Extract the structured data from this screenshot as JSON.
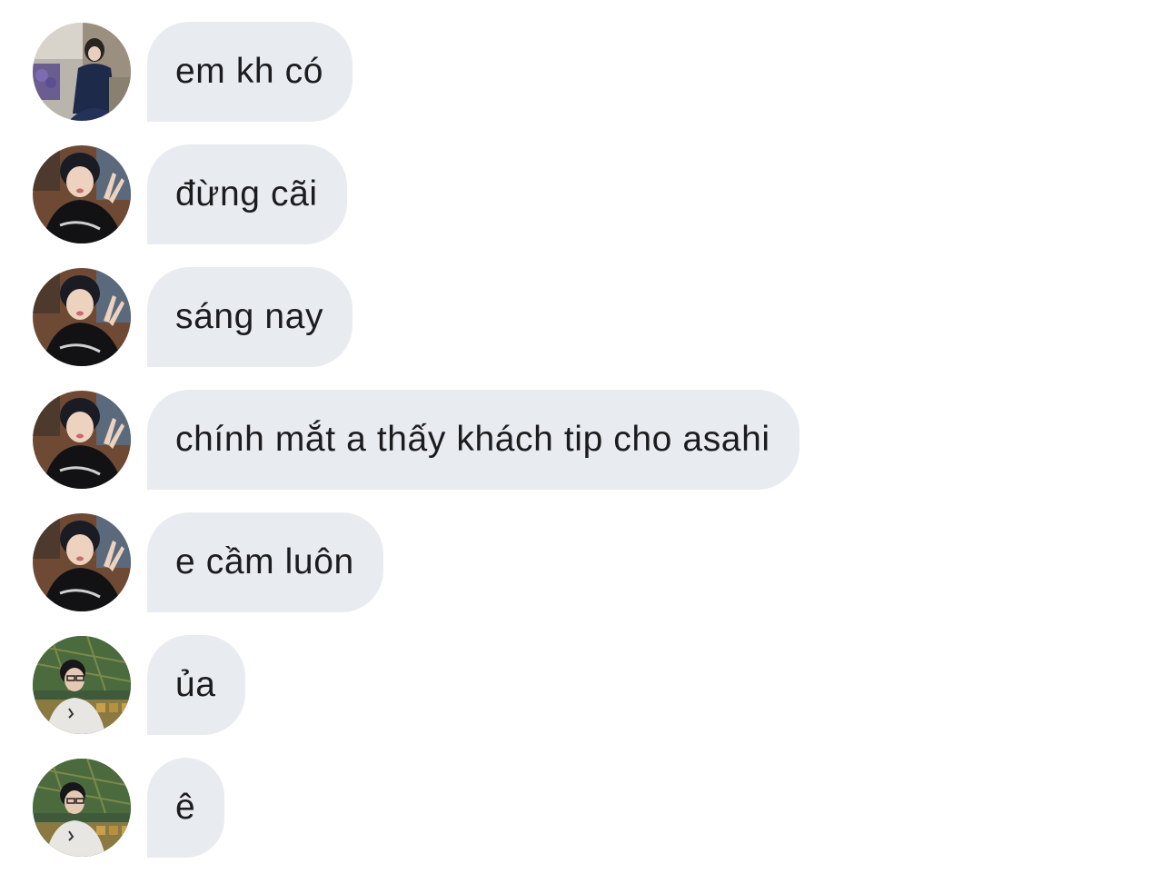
{
  "messages": [
    {
      "sender": "girl",
      "text": "em kh có"
    },
    {
      "sender": "boy-black-shirt",
      "text": "đừng cãi"
    },
    {
      "sender": "boy-black-shirt",
      "text": "sáng nay"
    },
    {
      "sender": "boy-black-shirt",
      "text": "chính mắt a thấy khách tip cho asahi"
    },
    {
      "sender": "boy-black-shirt",
      "text": "e cầm luôn"
    },
    {
      "sender": "boy-glasses",
      "text": "ủa"
    },
    {
      "sender": "boy-glasses",
      "text": "ê"
    }
  ],
  "colors": {
    "bubble": "#e8ecf0",
    "text": "#1c1c1e",
    "background": "#ffffff"
  }
}
